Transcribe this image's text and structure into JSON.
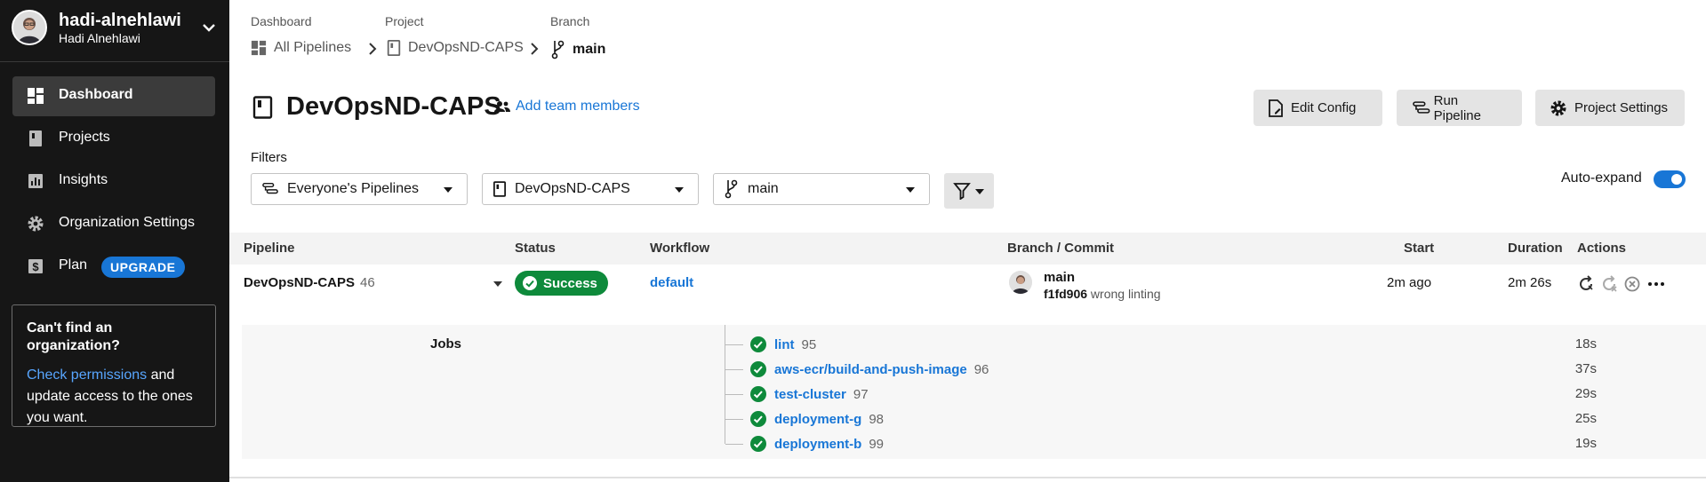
{
  "user": {
    "handle": "hadi-alnehlawi",
    "name": "Hadi Alnehlawi"
  },
  "sidebar": {
    "items": [
      {
        "label": "Dashboard",
        "icon": "dashboard-icon",
        "active": true
      },
      {
        "label": "Projects",
        "icon": "book-icon"
      },
      {
        "label": "Insights",
        "icon": "chart-icon"
      },
      {
        "label": "Organization Settings",
        "icon": "gear-icon"
      },
      {
        "label": "Plan",
        "icon": "dollar-icon",
        "badge": "UPGRADE"
      }
    ],
    "org_card": {
      "title": "Can't find an organization?",
      "link": "Check permissions",
      "text": " and update access to the ones you want."
    }
  },
  "breadcrumb": {
    "dashboard_head": "Dashboard",
    "dashboard_val": "All Pipelines",
    "project_head": "Project",
    "project_val": "DevOpsND-CAPS",
    "branch_head": "Branch",
    "branch_val": "main"
  },
  "project": {
    "title": "DevOpsND-CAPS",
    "add_team": "Add team members"
  },
  "toolbar": {
    "edit_config": "Edit Config",
    "run_pipeline": "Run Pipeline",
    "project_settings": "Project Settings"
  },
  "filters": {
    "label": "Filters",
    "pipelines": "Everyone's Pipelines",
    "project": "DevOpsND-CAPS",
    "branch": "main",
    "auto_expand": "Auto-expand"
  },
  "table": {
    "headers": {
      "pipeline": "Pipeline",
      "status": "Status",
      "workflow": "Workflow",
      "branch_commit": "Branch / Commit",
      "start": "Start",
      "duration": "Duration",
      "actions": "Actions"
    },
    "row": {
      "pipeline": "DevOpsND-CAPS",
      "number": "46",
      "status": "Success",
      "workflow": "default",
      "branch": "main",
      "commit_hash": "f1fd906",
      "commit_msg": "wrong linting",
      "start": "2m ago",
      "duration": "2m 26s"
    },
    "jobs_label": "Jobs",
    "jobs": [
      {
        "name": "lint",
        "number": "95",
        "duration": "18s"
      },
      {
        "name": "aws-ecr/build-and-push-image",
        "number": "96",
        "duration": "37s"
      },
      {
        "name": "test-cluster",
        "number": "97",
        "duration": "29s"
      },
      {
        "name": "deployment-g",
        "number": "98",
        "duration": "25s"
      },
      {
        "name": "deployment-b",
        "number": "99",
        "duration": "19s"
      }
    ]
  },
  "colors": {
    "accent": "#1876d6",
    "success": "#0e8a3b",
    "sidebar_bg": "#161616"
  }
}
